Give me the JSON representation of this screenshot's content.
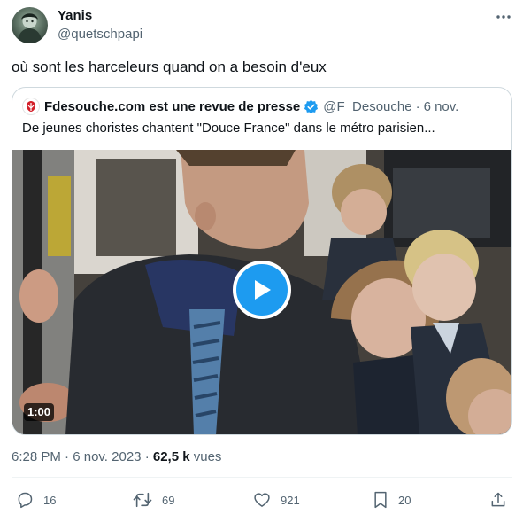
{
  "author": {
    "name": "Yanis",
    "handle": "@quetschpapi"
  },
  "tweet": {
    "text": "où sont les harceleurs quand on a besoin d'eux"
  },
  "quoted": {
    "name": "Fdesouche.com est une revue de presse",
    "handle": "@F_Desouche",
    "separator": "·",
    "date": "6 nov.",
    "text": "De jeunes choristes chantent \"Douce France\" dans le métro parisien...",
    "video_duration": "1:00"
  },
  "meta": {
    "time": "6:28 PM",
    "separator": "·",
    "date": "6 nov. 2023",
    "views_count": "62,5 k",
    "views_label": "vues"
  },
  "actions": {
    "replies": "16",
    "retweets": "69",
    "likes": "921",
    "bookmarks": "20"
  },
  "colors": {
    "accent": "#1d9bf0",
    "text_primary": "#0f1419",
    "text_secondary": "#536471",
    "border": "#cfd9de"
  },
  "icons": [
    "more-options-icon",
    "verified-badge-icon",
    "fdesouche-logo-icon",
    "play-icon",
    "reply-icon",
    "retweet-icon",
    "like-icon",
    "bookmark-icon",
    "share-icon"
  ]
}
